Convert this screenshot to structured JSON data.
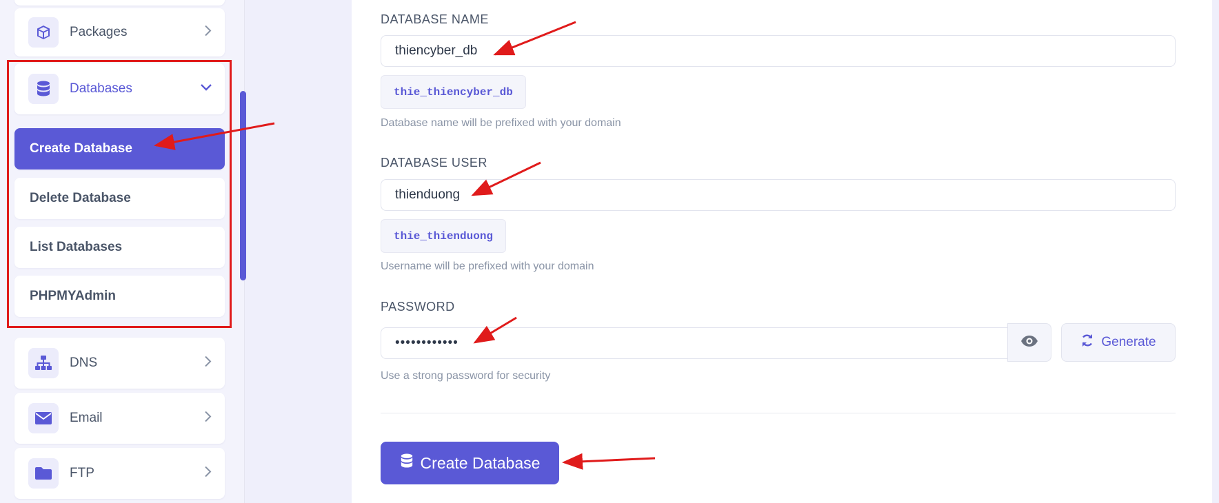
{
  "sidebar": {
    "items": [
      {
        "label": "Packages",
        "icon": "box-icon"
      },
      {
        "label": "Databases",
        "icon": "database-icon",
        "expanded": true
      },
      {
        "label": "DNS",
        "icon": "sitemap-icon"
      },
      {
        "label": "Email",
        "icon": "envelope-icon"
      },
      {
        "label": "FTP",
        "icon": "folder-icon"
      }
    ],
    "submenu": [
      {
        "label": "Create Database",
        "active": true
      },
      {
        "label": "Delete Database"
      },
      {
        "label": "List Databases"
      },
      {
        "label": "PHPMYAdmin"
      }
    ]
  },
  "form": {
    "db_name": {
      "label": "DATABASE NAME",
      "value": "thiencyber_db",
      "prefixed": "thie_thiencyber_db",
      "help": "Database name will be prefixed with your domain"
    },
    "db_user": {
      "label": "DATABASE USER",
      "value": "thienduong",
      "prefixed": "thie_thienduong",
      "help": "Username will be prefixed with your domain"
    },
    "password": {
      "label": "PASSWORD",
      "value": "••••••••••••",
      "help": "Use a strong password for security",
      "generate_label": "Generate"
    },
    "submit_label": "Create Database"
  },
  "colors": {
    "accent": "#5a59d6",
    "annotation": "#e01b1b",
    "background": "#efeffb"
  }
}
